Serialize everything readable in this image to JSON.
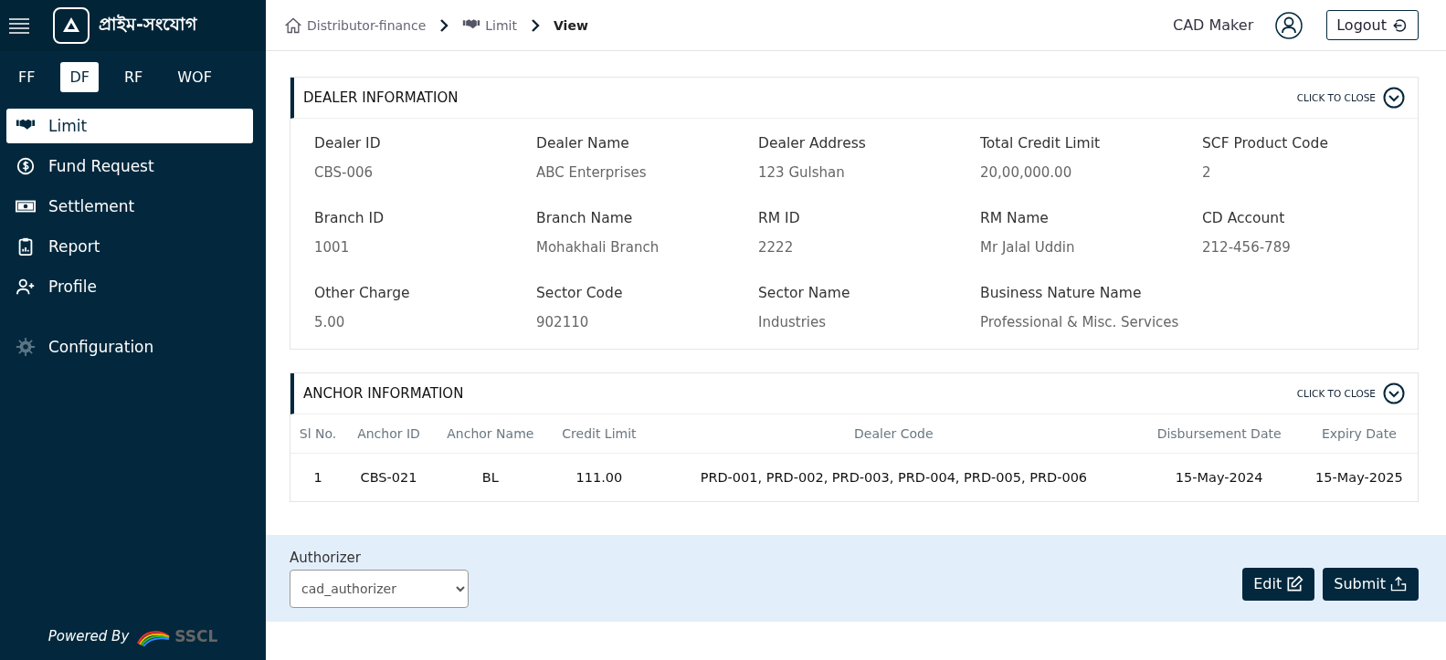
{
  "sidebar": {
    "brand": "প্রাইম-সংযোগ",
    "tabs": [
      {
        "label": "FF",
        "selected": false
      },
      {
        "label": "DF",
        "selected": true
      },
      {
        "label": "RF",
        "selected": false
      },
      {
        "label": "WOF",
        "selected": false
      }
    ],
    "items": [
      {
        "label": "Limit",
        "selected": true
      },
      {
        "label": "Fund Request",
        "selected": false
      },
      {
        "label": "Settlement",
        "selected": false
      },
      {
        "label": "Report",
        "selected": false
      },
      {
        "label": "Profile",
        "selected": false
      },
      {
        "label": "Configuration",
        "selected": false
      }
    ],
    "powered_by": "Powered By",
    "vendor": "SSCL"
  },
  "breadcrumb": [
    {
      "label": "Distributor-finance"
    },
    {
      "label": "Limit"
    },
    {
      "label": "View"
    }
  ],
  "user": {
    "name": "CAD Maker",
    "logout": "Logout"
  },
  "dealer": {
    "title": "DEALER INFORMATION",
    "toggle": "CLICK TO CLOSE",
    "fields": [
      {
        "label": "Dealer ID",
        "value": "CBS-006"
      },
      {
        "label": "Dealer Name",
        "value": "ABC Enterprises"
      },
      {
        "label": "Dealer Address",
        "value": "123 Gulshan"
      },
      {
        "label": "Total Credit Limit",
        "value": "20,00,000.00"
      },
      {
        "label": "SCF Product Code",
        "value": "2"
      },
      {
        "label": "Branch ID",
        "value": "1001"
      },
      {
        "label": "Branch Name",
        "value": "Mohakhali Branch"
      },
      {
        "label": "RM ID",
        "value": "2222"
      },
      {
        "label": "RM Name",
        "value": "Mr Jalal Uddin"
      },
      {
        "label": "CD Account",
        "value": "212-456-789"
      },
      {
        "label": "Other Charge",
        "value": "5.00"
      },
      {
        "label": "Sector Code",
        "value": "902110"
      },
      {
        "label": "Sector Name",
        "value": "Industries"
      },
      {
        "label": "Business Nature Name",
        "value": "Professional & Misc. Services"
      }
    ]
  },
  "anchor": {
    "title": "ANCHOR INFORMATION",
    "toggle": "CLICK TO CLOSE",
    "columns": [
      "Sl No.",
      "Anchor ID",
      "Anchor Name",
      "Credit Limit",
      "Dealer Code",
      "Disbursement Date",
      "Expiry Date"
    ],
    "rows": [
      [
        "1",
        "CBS-021",
        "BL",
        "111.00",
        "PRD-001, PRD-002, PRD-003, PRD-004, PRD-005, PRD-006",
        "15-May-2024",
        "15-May-2025"
      ]
    ]
  },
  "footer": {
    "label": "Authorizer",
    "select_value": "cad_authorizer",
    "buttons": [
      {
        "label": "Edit"
      },
      {
        "label": "Submit"
      }
    ]
  }
}
